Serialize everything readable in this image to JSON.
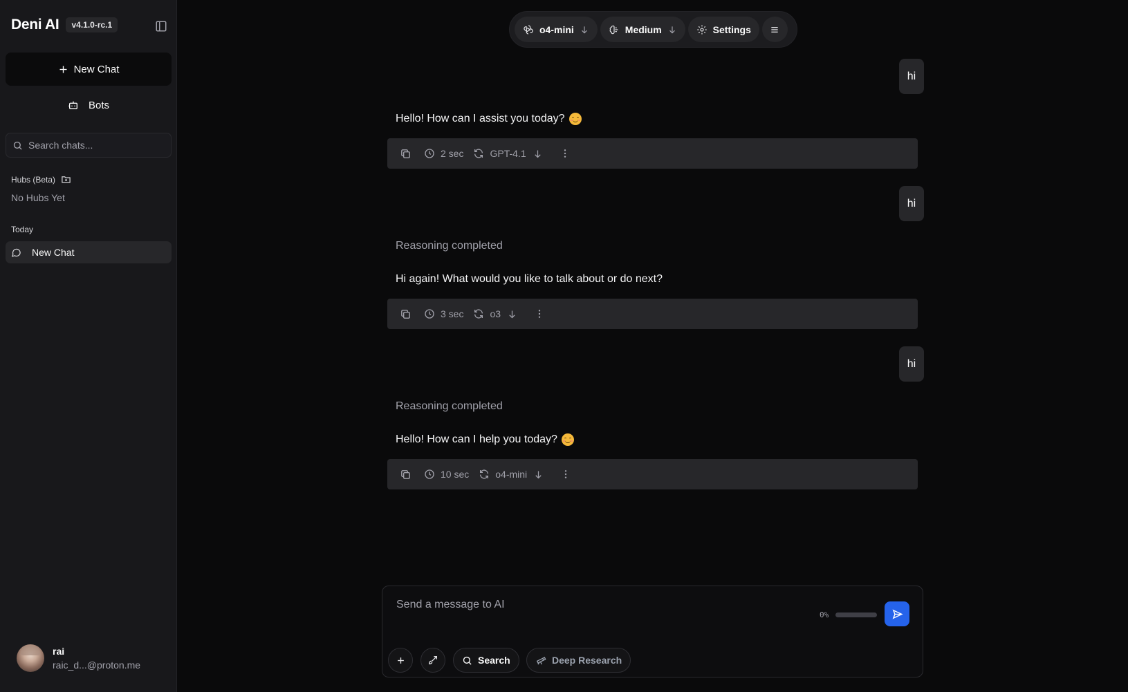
{
  "sidebar": {
    "brand_title": "Deni AI",
    "version": "v4.1.0-rc.1",
    "new_chat_label": "New Chat",
    "bots_label": "Bots",
    "search_placeholder": "Search chats...",
    "hubs_label": "Hubs (Beta)",
    "no_hubs_label": "No Hubs Yet",
    "today_label": "Today",
    "chats": [
      {
        "label": "New Chat"
      }
    ],
    "user": {
      "name": "rai",
      "email": "raic_d...@proton.me"
    }
  },
  "toolbar": {
    "model_label": "o4-mini",
    "effort_label": "Medium",
    "settings_label": "Settings"
  },
  "messages": [
    {
      "user": "hi",
      "reasoning": "",
      "reply": "Hello! How can I assist you today?",
      "duration": "2 sec",
      "model": "GPT-4.1"
    },
    {
      "user": "hi",
      "reasoning": "Reasoning completed",
      "reply": "Hi again! What would you like to talk about or do next?",
      "duration": "3 sec",
      "model": "o3"
    },
    {
      "user": "hi",
      "reasoning": "Reasoning completed",
      "reply": "Hello! How can I help you today?",
      "duration": "10 sec",
      "model": "o4-mini"
    }
  ],
  "composer": {
    "placeholder": "Send a message to AI",
    "progress_label": "0%",
    "progress_fraction": 0,
    "search_label": "Search",
    "deep_research_label": "Deep Research"
  },
  "colors": {
    "accent": "#2563eb",
    "background": "#0a0a0b",
    "sidebar": "#18181b",
    "surface": "#27272a"
  },
  "icons": [
    "sidebar-toggle-icon",
    "plus-icon",
    "bot-icon",
    "search-icon",
    "folder-plus-icon",
    "message-circle-icon",
    "openai-icon",
    "brain-icon",
    "gear-icon",
    "menu-icon",
    "copy-icon",
    "clock-icon",
    "refresh-icon",
    "arrow-down-icon",
    "more-vertical-icon",
    "send-icon",
    "brush-icon",
    "telescope-icon",
    "smiling-emoji-icon"
  ]
}
